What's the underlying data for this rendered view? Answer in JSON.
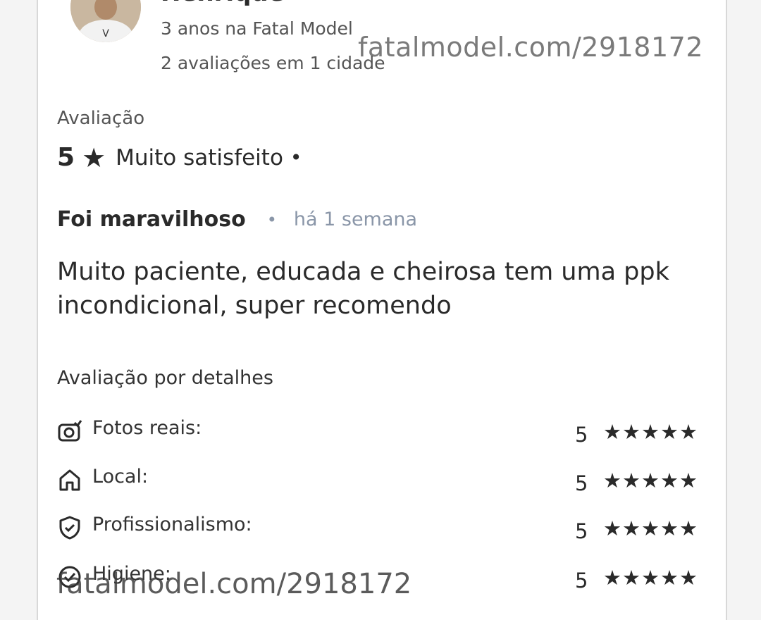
{
  "reviewer": {
    "name": "Henrique",
    "tenure": "3 anos na Fatal Model",
    "stats": "2 avaliações em 1 cidade"
  },
  "watermark": "fatalmodel.com/2918172",
  "rating": {
    "label": "Avaliação",
    "score": "5",
    "star": "★",
    "text": "Muito satisfeito",
    "dot": "•"
  },
  "review": {
    "title": "Foi maravilhoso",
    "dot": "•",
    "time": "há 1 semana",
    "body": "Muito paciente, educada e cheirosa tem uma ppk incondicional, super recomendo"
  },
  "details": {
    "title": "Avaliação por detalhes",
    "items": [
      {
        "icon": "camera-icon",
        "label": "Fotos reais:",
        "score": "5",
        "stars": "★★★★★"
      },
      {
        "icon": "home-icon",
        "label": "Local:",
        "score": "5",
        "stars": "★★★★★"
      },
      {
        "icon": "shield-check-icon",
        "label": "Profissionalismo:",
        "score": "5",
        "stars": "★★★★★"
      },
      {
        "icon": "check-circle-icon",
        "label": "Higiene:",
        "score": "5",
        "stars": "★★★★★"
      }
    ]
  }
}
